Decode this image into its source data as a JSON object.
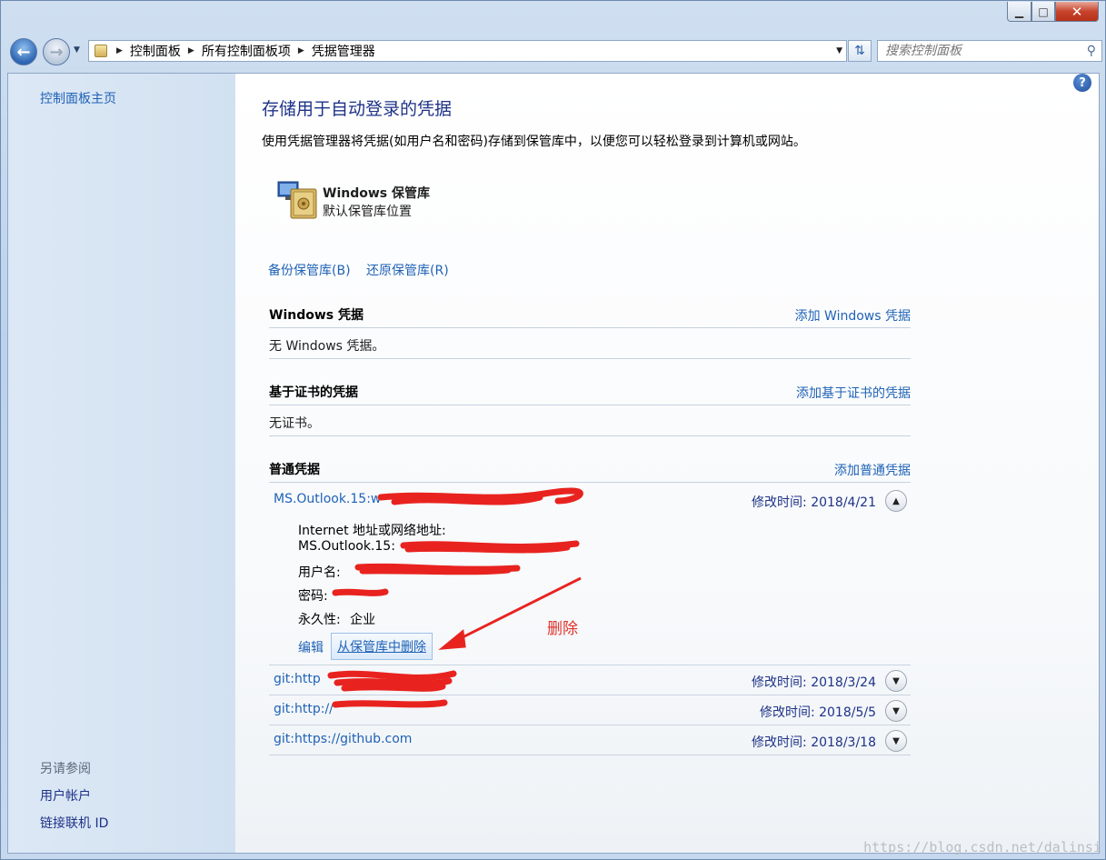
{
  "window": {
    "min_label": "▁",
    "max_label": "□",
    "close_label": "✕"
  },
  "nav": {
    "breadcrumb": [
      "控制面板",
      "所有控制面板项",
      "凭据管理器"
    ],
    "search_placeholder": "搜索控制面板"
  },
  "sidebar": {
    "home": "控制面板主页",
    "see_also": "另请参阅",
    "links": [
      "用户帐户",
      "链接联机 ID"
    ]
  },
  "main": {
    "title": "存储用于自动登录的凭据",
    "description": "使用凭据管理器将凭据(如用户名和密码)存储到保管库中，以便您可以轻松登录到计算机或网站。",
    "vault": {
      "name": "Windows 保管库",
      "subtitle": "默认保管库位置"
    },
    "backup_link": "备份保管库(B)",
    "restore_link": "还原保管库(R)",
    "windows_section": {
      "heading": "Windows 凭据",
      "add_link": "添加 Windows 凭据",
      "empty": "无 Windows 凭据。"
    },
    "cert_section": {
      "heading": "基于证书的凭据",
      "add_link": "添加基于证书的凭据",
      "empty": "无证书。"
    },
    "generic_section": {
      "heading": "普通凭据",
      "add_link": "添加普通凭据"
    },
    "expanded_credential": {
      "name": "MS.Outlook.15:w",
      "modified": "修改时间:  2018/4/21",
      "address_label": "Internet 地址或网络地址:",
      "address_value": "MS.Outlook.15:",
      "username_label": "用户名:",
      "password_label": "密码:",
      "persistence_label": "永久性:",
      "persistence_value": "企业",
      "edit": "编辑",
      "delete": "从保管库中删除"
    },
    "credentials": [
      {
        "name": "git:http",
        "modified": "修改时间:  2018/3/24"
      },
      {
        "name": "git:http://",
        "modified": "修改时间:  2018/5/5"
      },
      {
        "name": "git:https://github.com",
        "modified": "修改时间:  2018/3/18"
      }
    ],
    "annotation": "删除"
  },
  "watermark": "https://blog.csdn.net/dalinsi",
  "colors": {
    "link": "#1f62b6",
    "title": "#1e3287",
    "annotation_red": "#e0322b"
  }
}
